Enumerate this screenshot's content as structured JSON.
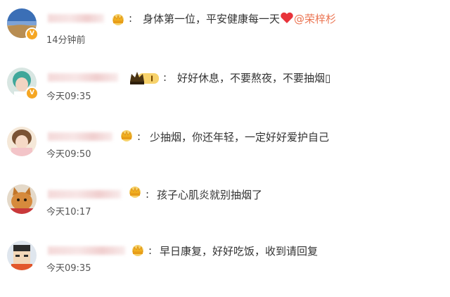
{
  "comments": [
    {
      "text": "身体第一位，平安健康每一天",
      "mention": "@荣梓杉",
      "time": "14分钟前",
      "avatar_icon": "landscape-avatar",
      "verified": true
    },
    {
      "text": "好好休息，不要熬夜，不要抽烟",
      "trailing": "▯",
      "time": "今天09:35",
      "avatar_icon": "teal-hair-avatar",
      "verified": true,
      "vip_level": "I"
    },
    {
      "text": "少抽烟，你还年轻，一定好好爱护自己",
      "time": "今天09:50",
      "avatar_icon": "girl-avatar",
      "verified": false
    },
    {
      "text": "孩子心肌炎就别抽烟了",
      "time": "今天10:17",
      "avatar_icon": "cat-avatar",
      "verified": false
    },
    {
      "text": "早日康复，好好吃饭，收到请回复",
      "time": "今天09:35",
      "avatar_icon": "cartoon-boy-avatar",
      "verified": false
    }
  ],
  "colors": {
    "mention": "#eb7350",
    "text": "#333333",
    "time": "#555555",
    "crown_gold": "#f2b01e",
    "heart": "#e8333a"
  },
  "verified_badge": "V"
}
